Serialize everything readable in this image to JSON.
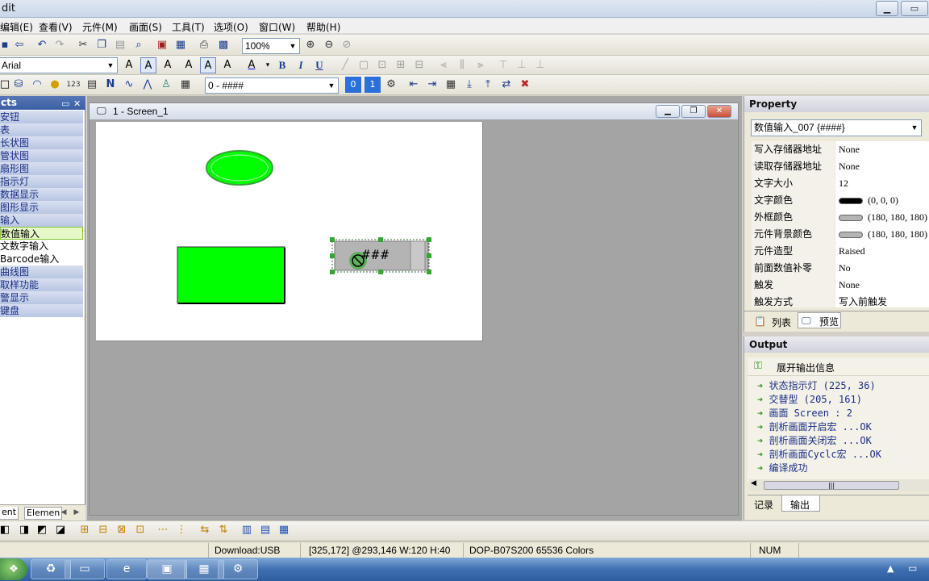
{
  "window": {
    "title": "dit"
  },
  "menu": [
    "编辑(E)",
    "查看(V)",
    "元件(M)",
    "画面(S)",
    "工具(T)",
    "选项(O)",
    "窗口(W)",
    "帮助(H)"
  ],
  "toolbar": {
    "zoom": "100%",
    "font_name": "Arial",
    "format_value": "0 - ####"
  },
  "objects_panel": {
    "title": "cts",
    "items": [
      {
        "label": "安钮",
        "type": "cat"
      },
      {
        "label": "表",
        "type": "cat"
      },
      {
        "label": "长状图",
        "type": "cat"
      },
      {
        "label": "管状图",
        "type": "cat"
      },
      {
        "label": "扇形图",
        "type": "cat"
      },
      {
        "label": "指示灯",
        "type": "cat"
      },
      {
        "label": "数据显示",
        "type": "cat"
      },
      {
        "label": "图形显示",
        "type": "cat"
      },
      {
        "label": "输入",
        "type": "cat"
      },
      {
        "label": "数值输入",
        "type": "active"
      },
      {
        "label": "文数字输入",
        "type": "sub"
      },
      {
        "label": "Barcode输入",
        "type": "sub"
      },
      {
        "label": "曲线图",
        "type": "cat"
      },
      {
        "label": "取样功能",
        "type": "cat"
      },
      {
        "label": "警显示",
        "type": "cat"
      },
      {
        "label": "键盘",
        "type": "cat"
      }
    ],
    "tabs": [
      "ent",
      "Elemen"
    ]
  },
  "screen_window": {
    "title": "1 - Screen_1"
  },
  "canvas": {
    "numeric_input_text": "###"
  },
  "property": {
    "title": "Property",
    "selected": "数值输入_007 {####}",
    "rows": [
      {
        "key": "写入存储器地址",
        "value": "None"
      },
      {
        "key": "读取存储器地址",
        "value": "None"
      },
      {
        "key": "文字大小",
        "value": "12"
      },
      {
        "key": "文字颜色",
        "value": "(0, 0, 0)",
        "swatch": "#000000"
      },
      {
        "key": "外框颜色",
        "value": "(180, 180, 180)",
        "swatch": "#b4b4b4"
      },
      {
        "key": "元件背景颜色",
        "value": "(180, 180, 180)",
        "swatch": "#b4b4b4"
      },
      {
        "key": "元件造型",
        "value": "Raised"
      },
      {
        "key": "前面数值补零",
        "value": "No"
      },
      {
        "key": "触发",
        "value": "None"
      },
      {
        "key": "触发方式",
        "value": "写入前触发"
      }
    ],
    "tabs": [
      "列表",
      "预览"
    ]
  },
  "output": {
    "title": "Output",
    "expand_label": "展开输出信息",
    "lines": [
      "状态指示灯 (225, 36)",
      "交替型 (205, 161)",
      "画面 Screen : 2",
      " 剖析画面开启宏 ...OK",
      " 剖析画面关闭宏 ...OK",
      " 剖析画面Cyclc宏 ...OK",
      "编译成功"
    ],
    "tabs": [
      "记录",
      "输出"
    ]
  },
  "status": {
    "download": "Download:USB",
    "coords": "[325,172] @293,146 W:120 H:40",
    "model": "DOP-B07S200 65536 Colors",
    "num": "NUM"
  },
  "colors": {
    "accent": "#3c5ea4",
    "shape_green": "#00ff00"
  }
}
